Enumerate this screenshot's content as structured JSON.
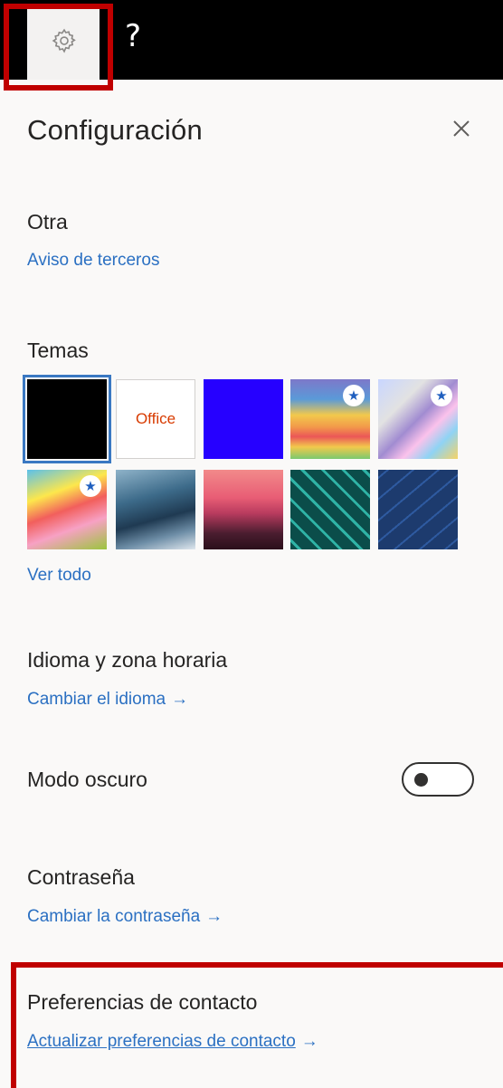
{
  "topbar": {
    "icons": [
      "gear-icon",
      "help-icon"
    ],
    "help_label": "?"
  },
  "panel": {
    "title": "Configuración",
    "close_icon": "close-icon"
  },
  "sections": {
    "other": {
      "heading": "Otra",
      "link": "Aviso de terceros"
    },
    "themes": {
      "heading": "Temas",
      "office_label": "Office",
      "see_all": "Ver todo",
      "star_glyph": "★"
    },
    "language": {
      "heading": "Idioma y zona horaria",
      "link": "Cambiar el idioma"
    },
    "dark_mode": {
      "heading": "Modo oscuro",
      "enabled": false
    },
    "password": {
      "heading": "Contraseña",
      "link": "Cambiar la contraseña"
    },
    "contact": {
      "heading": "Preferencias de contacto",
      "link": "Actualizar preferencias de contacto"
    }
  },
  "arrow_glyph": "→",
  "colors": {
    "highlight": "#c00000",
    "link": "#2b70c2",
    "panel_bg": "#faf9f8",
    "topbar_bg": "#000000"
  }
}
